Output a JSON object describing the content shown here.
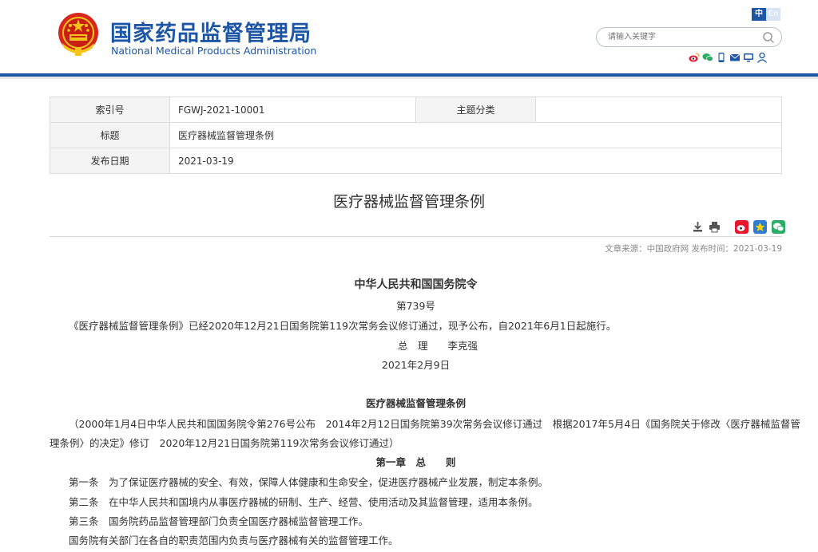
{
  "header": {
    "title_cn": "国家药品监督管理局",
    "title_en": "National Medical Products Administration",
    "lang_zh": "中",
    "lang_en": "En",
    "search_placeholder": "请输入关键字"
  },
  "social_icons": [
    "weibo-icon",
    "wechat-icon",
    "mobile-icon",
    "mail-icon",
    "tv-icon",
    "user-icon"
  ],
  "meta": {
    "index_label": "索引号",
    "index_value": "FGWJ-2021-10001",
    "category_label": "主题分类",
    "category_value": "",
    "title_label": "标题",
    "title_value": "医疗器械监督管理条例",
    "date_label": "发布日期",
    "date_value": "2021-03-19"
  },
  "doc": {
    "title": "医疗器械监督管理条例",
    "source": "文章来源：中国政府网  发布时间：2021-03-19"
  },
  "content": {
    "order_title": "中华人民共和国国务院令",
    "order_no": "第739号",
    "intro": "《医疗器械监督管理条例》已经2020年12月21日国务院第119次常务会议修订通过，现予公布，自2021年6月1日起施行。",
    "premier": "总　理　　李克强",
    "sign_date": "2021年2月9日",
    "reg_title": "医疗器械监督管理条例",
    "history_1": "（2000年1月4日中华人民共和国国务院令第276号公布　2014年2月12日国务院第39次常务会议修订通过　根据2017年5月4日《国务院关于修改〈医疗器械监督管",
    "history_2": "理条例〉的决定》修订　2020年12月21日国务院第119次常务会议修订通过）",
    "chapter_1": "第一章　总　　则",
    "art_1": "第一条　为了保证医疗器械的安全、有效，保障人体健康和生命安全，促进医疗器械产业发展，制定本条例。",
    "art_2": "第二条　在中华人民共和国境内从事医疗器械的研制、生产、经营、使用活动及其监督管理，适用本条例。",
    "art_3": "第三条　国务院药品监督管理部门负责全国医疗器械监督管理工作。",
    "art_3b": "国务院有关部门在各自的职责范围内负责与医疗器械有关的监督管理工作。"
  }
}
